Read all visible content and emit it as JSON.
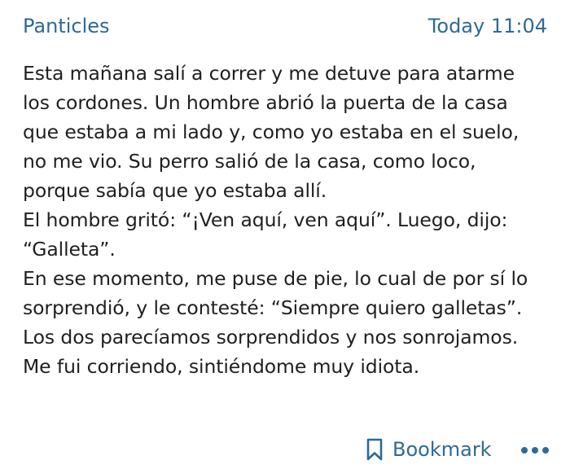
{
  "header": {
    "author": "Panticles",
    "timestamp": "Today 11:04"
  },
  "post": {
    "lines": [
      "Esta mañana salí a correr y me detuve para atarme",
      "los cordones. Un hombre abrió la puerta de la casa",
      "que estaba a mi lado y, como yo estaba en el suelo,",
      "no me vio. Su perro salió de la casa, como loco,",
      "porque sabía que yo estaba allí.",
      "El hombre gritó: “¡Ven aquí, ven aquí”. Luego, dijo:",
      "“Galleta”.",
      "En ese momento, me puse de pie, lo cual de por sí lo",
      "sorprendió, y le contesté: “Siempre quiero galletas”.",
      "Los dos parecíamos sorprendidos y nos sonrojamos.",
      "Me fui corriendo, sintiéndome muy idiota."
    ]
  },
  "footer": {
    "bookmark_label": "Bookmark",
    "bookmark_icon": "bookmark-icon",
    "more_icon": "more-options-icon"
  },
  "colors": {
    "accent": "#2e6a97",
    "text": "#1f1f1f",
    "background": "#ffffff"
  }
}
